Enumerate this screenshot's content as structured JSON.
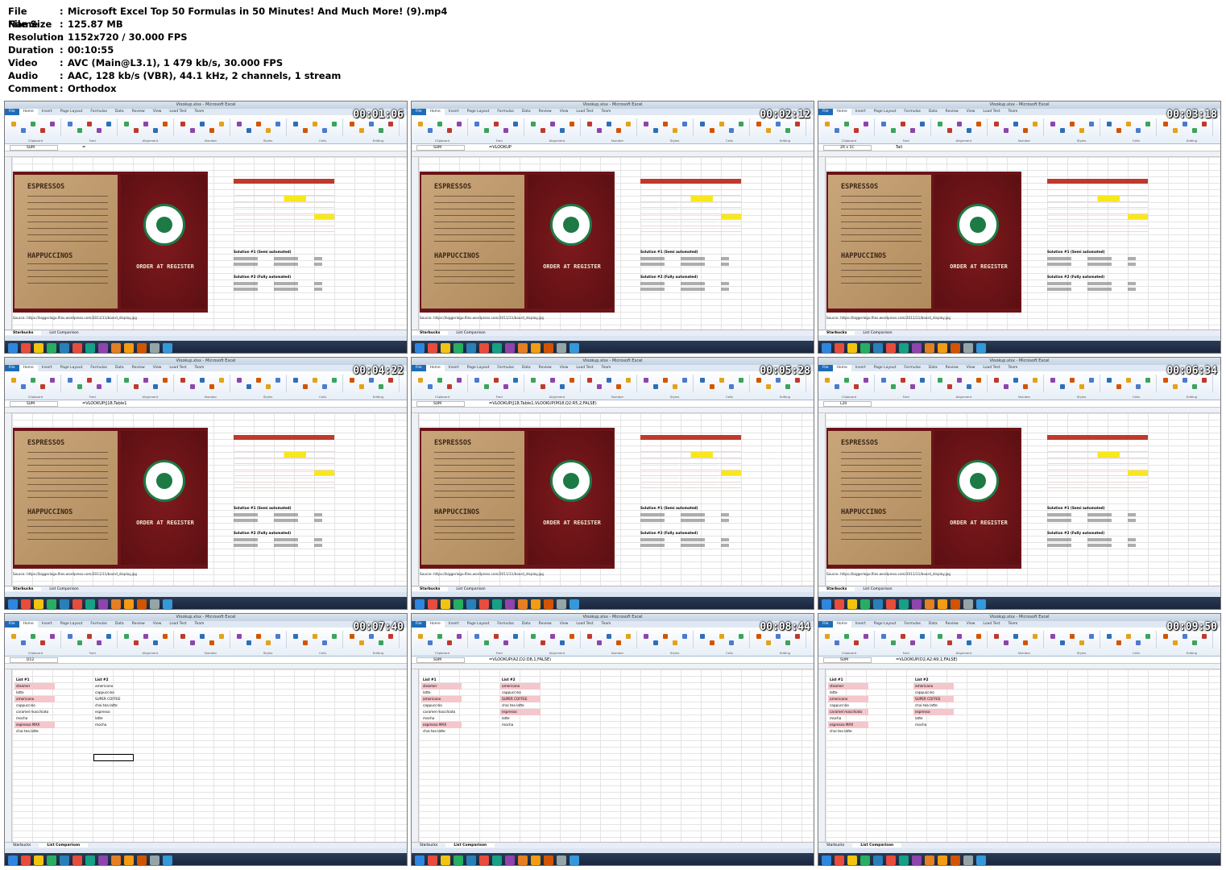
{
  "header": {
    "rows": [
      {
        "key": "File Name",
        "value": "Microsoft Excel Top 50 Formulas in 50 Minutes! And Much More! (9).mp4"
      },
      {
        "key": "File Size",
        "value": "125.87 MB"
      },
      {
        "key": "Resolution",
        "value": "1152x720 / 30.000 FPS"
      },
      {
        "key": "Duration",
        "value": "00:10:55"
      },
      {
        "key": "Video",
        "value": "AVC (Main@L3.1), 1 479 kb/s, 30.000 FPS"
      },
      {
        "key": "Audio",
        "value": "AAC, 128 kb/s (VBR), 44.1 kHz, 2 channels, 1 stream"
      },
      {
        "key": "Comment",
        "value": "Orthodox"
      }
    ]
  },
  "common": {
    "window_title": "Vlookup.xlsx - Microsoft Excel",
    "tabs": [
      "File",
      "Home",
      "Insert",
      "Page Layout",
      "Formulas",
      "Data",
      "Review",
      "View",
      "Load Test",
      "Team"
    ],
    "groups": [
      "Clipboard",
      "Font",
      "Alignment",
      "Number",
      "Styles",
      "Cells",
      "Editing"
    ],
    "menu": {
      "espressos": "ESPRESSOS",
      "happuccinos": "HAPPUCCINOS",
      "order": "ORDER AT REGISTER"
    },
    "solution1": "Solution #1 (Semi automated)",
    "solution2": "Solution #2 (Fully automated)",
    "source": "Source: https://biggerlogo.files.wordpress.com/2011/11/board_display.jpg",
    "sheet_tabs": [
      "Starbucks",
      "List Comparison"
    ]
  },
  "thumbs": [
    {
      "time": "00:01:06",
      "name": "SUM",
      "formula": "="
    },
    {
      "time": "00:02:12",
      "name": "SUM",
      "formula": "=VLOOKUP"
    },
    {
      "time": "00:03:18",
      "name": "2R x 1C",
      "formula": "Tall"
    },
    {
      "time": "00:04:22",
      "name": "SUM",
      "formula": "=VLOOKUP(J18,Table1"
    },
    {
      "time": "00:05:28",
      "name": "SUM",
      "formula": "=VLOOKUP(J18,Table1,VLOOKUP(M18,Q2:R5,2,FALSE)"
    },
    {
      "time": "00:06:34",
      "name": "L20",
      "formula": ""
    },
    {
      "time": "00:07:40",
      "name": "D12",
      "formula": ""
    },
    {
      "time": "00:08:44",
      "name": "SUM",
      "formula": "=VLOOKUP(A2,D2:D8,1,FALSE)"
    },
    {
      "time": "00:09:50",
      "name": "SUM",
      "formula": "=VLOOKUP(D2,A2:A9,1,FALSE)"
    }
  ],
  "list_sheet": {
    "list1_title": "List #1",
    "list1": [
      "steamer",
      "latte",
      "americano",
      "cappuccino",
      "caramel macchiato",
      "mocha",
      "espresso MAX",
      "chai tea latte"
    ],
    "list2_title": "List #2",
    "list2": [
      "americano",
      "cappuccino",
      "SUPER COFFEE",
      "chai tea latte",
      "espresso",
      "latte",
      "mocha"
    ]
  }
}
